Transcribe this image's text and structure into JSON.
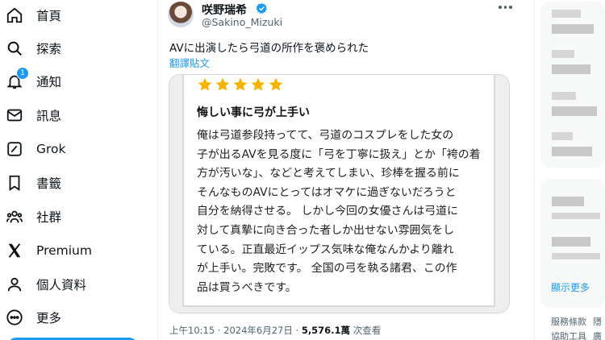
{
  "sidebar": {
    "items": [
      {
        "label": "首頁",
        "icon": "home-icon"
      },
      {
        "label": "探索",
        "icon": "search-icon"
      },
      {
        "label": "通知",
        "icon": "bell-icon",
        "badge": "1"
      },
      {
        "label": "訊息",
        "icon": "mail-icon"
      },
      {
        "label": "Grok",
        "icon": "grok-icon"
      },
      {
        "label": "書籤",
        "icon": "bookmark-icon"
      },
      {
        "label": "社群",
        "icon": "communities-icon"
      },
      {
        "label": "Premium",
        "icon": "x-logo-icon"
      },
      {
        "label": "個人資料",
        "icon": "profile-icon"
      },
      {
        "label": "更多",
        "icon": "more-circle-icon"
      }
    ]
  },
  "tweet": {
    "author_name": "咲野瑞希",
    "author_handle": "@Sakino_Mizuki",
    "text": "AVに出演したら弓道の所作を褒められた",
    "translate_label": "翻譯貼文",
    "review": {
      "stars": 5,
      "title": "悔しい事に弓が上手い",
      "lines": [
        "俺は弓道参段持ってて、弓道のコスプレをした女の",
        "子が出るAVを見る度に「弓を丁寧に扱え」とか「袴の着",
        "方が汚いな」、などと考えてしまい、珍棒を握る前に",
        "そんなものAVにとってはオマケに過ぎないだろうと",
        "自分を納得させる。 しかし今回の女優さんは弓道に",
        "対して真摯に向き合った者しか出せない雰囲気をし",
        "ている。正直最近イップス気味な俺なんかより離れ",
        "が上手い。完敗です。 全国の弓を執る諸君、この作",
        "品は買うべきです。"
      ]
    },
    "time": "上午10:15",
    "date": "2024年6月27日",
    "views_count": "5,576.1萬",
    "views_label": "次查看"
  },
  "right_panel": {
    "show_more": "顯示更多",
    "footer": [
      "服務條款",
      "隱",
      "協助工具",
      "廣"
    ]
  },
  "colors": {
    "accent": "#1d9bf0",
    "text": "#0f1419",
    "muted": "#536471",
    "star": "#f5b400"
  }
}
